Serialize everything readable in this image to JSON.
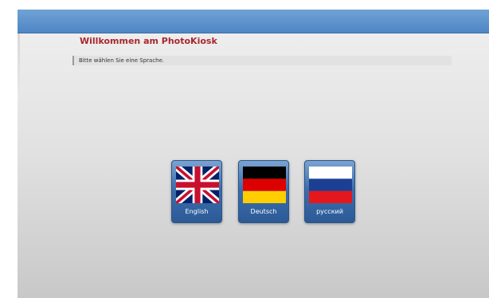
{
  "header": {
    "title": "Willkommen am PhotoKiosk",
    "subtitle": "Bitte wählen Sie eine Sprache."
  },
  "languages": [
    {
      "label": "English",
      "flag": "uk-flag-icon"
    },
    {
      "label": "Deutsch",
      "flag": "germany-flag-icon"
    },
    {
      "label": "русский",
      "flag": "russia-flag-icon"
    }
  ],
  "colors": {
    "topbar": "#4f86c4",
    "title": "#a8282d",
    "button": "#3c6fae"
  }
}
